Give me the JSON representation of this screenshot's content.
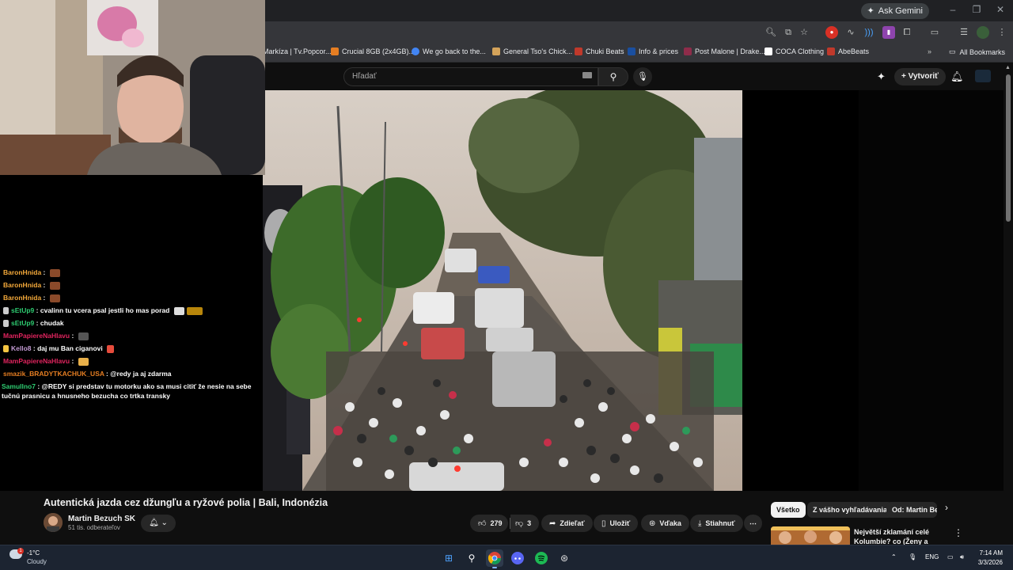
{
  "browser": {
    "ask_gemini": "Ask Gemini",
    "bookmarks": [
      {
        "label": "Markíza | Tv.Popcor...",
        "color": "#c0392b"
      },
      {
        "label": "Crucial 8GB (2x4GB)...",
        "color": "#e67e22"
      },
      {
        "label": "We go back to the...",
        "color": "#4285f4"
      },
      {
        "label": "General Tso's Chick...",
        "color": "#d4a35a"
      },
      {
        "label": "Chuki Beats",
        "color": "#c0392b"
      },
      {
        "label": "Info & prices",
        "color": "#1a4fa0"
      },
      {
        "label": "Post Malone | Drake...",
        "color": "#8e2c4a"
      },
      {
        "label": "COCA Clothing",
        "color": "#222222"
      },
      {
        "label": "AbeBeats",
        "color": "#c0392b"
      }
    ],
    "all_bookmarks": "All Bookmarks"
  },
  "youtube": {
    "search_placeholder": "Hľadať",
    "create_label": "Vytvoriť",
    "video": {
      "title": "Autentická jazda cez džungľu a ryžové polia | Bali, Indonézia",
      "channel": "Martin Bezuch SK",
      "subscribers": "51 tis. odberateľov",
      "likes": "279",
      "dislikes": "3",
      "share": "Zdieľať",
      "save": "Uložiť",
      "thanks": "Vďaka",
      "download": "Stiahnuť"
    },
    "chips": [
      {
        "label": "Všetko",
        "active": true
      },
      {
        "label": "Z vášho vyhľadávania",
        "active": false
      },
      {
        "label": "Od: Martin Bezuch",
        "active": false
      }
    ],
    "recommendation": {
      "title_line1": "Největší zklamání celé",
      "title_line2": "Kolumbie? co (Ženy a Krádeže)"
    }
  },
  "chat": [
    {
      "user": "BaronHnida",
      "color": "#f4a93a",
      "text": "",
      "emote": "#8b4a2a"
    },
    {
      "user": "BaronHnida",
      "color": "#f4a93a",
      "text": "",
      "emote": "#8b4a2a"
    },
    {
      "user": "BaronHnida",
      "color": "#f4a93a",
      "text": "",
      "emote": "#8b4a2a"
    },
    {
      "user": "sEtUp9",
      "color": "#2ecc71",
      "text": "cvalinn tu vcera psal jestli ho mas porad",
      "emote": "#b8860b"
    },
    {
      "user": "sEtUp9",
      "color": "#2ecc71",
      "text": "chudak",
      "emote": ""
    },
    {
      "user": "MamPapiereNaHlavu",
      "color": "#e0245e",
      "text": "",
      "emote": "#555555"
    },
    {
      "user": "Kello8",
      "color": "#c39bd3",
      "text": "daj mu Ban ciganovi",
      "emote": "#e74c3c"
    },
    {
      "user": "MamPapiereNaHlavu",
      "color": "#e0245e",
      "text": "",
      "emote": "#e8b04a"
    },
    {
      "user": "smazik_BRADYTKACHUK_USA",
      "color": "#e67e22",
      "text": "@redy ja aj zdarma",
      "emote": ""
    },
    {
      "user": "Samullno7",
      "color": "#2ecc71",
      "text": "@REDY si predstav tu motorku ako sa musi citiť že nesie na sebe tučnú prasnicu a hnusneho bezucha co trtka transky",
      "emote": ""
    }
  ],
  "taskbar": {
    "temperature": "-1°C",
    "condition": "Cloudy",
    "language": "ENG",
    "time": "7:14 AM",
    "date": "3/3/2026"
  }
}
